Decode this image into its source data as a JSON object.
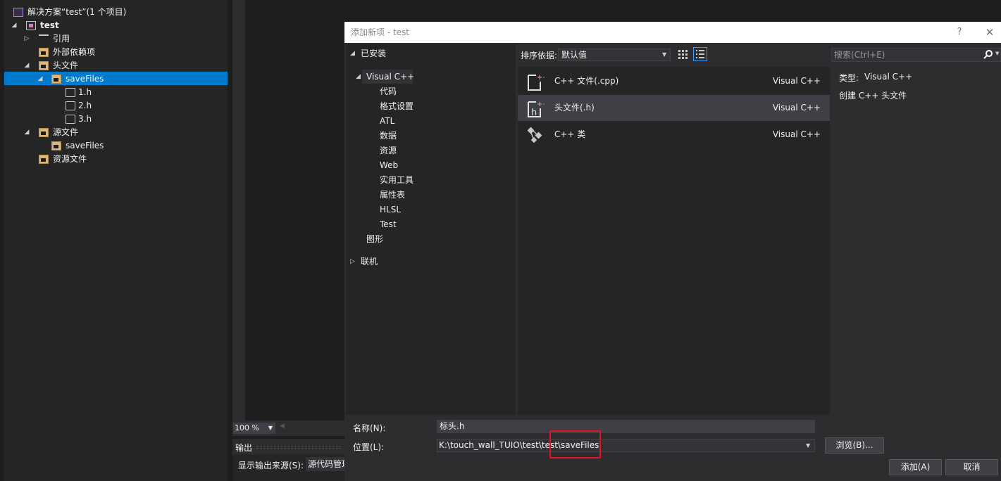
{
  "solution_explorer": {
    "solution_label": "解决方案“test”(1 个项目)",
    "project_label": "test",
    "items": [
      {
        "label": "引用"
      },
      {
        "label": "外部依赖项"
      },
      {
        "label": "头文件"
      },
      {
        "label": "saveFiles"
      },
      {
        "label": "1.h"
      },
      {
        "label": "2.h"
      },
      {
        "label": "3.h"
      },
      {
        "label": "源文件"
      },
      {
        "label": "saveFiles"
      },
      {
        "label": "资源文件"
      }
    ]
  },
  "editor": {
    "zoom": "100 %",
    "output_title": "输出",
    "output_source_label": "显示输出来源(S):",
    "output_source_value": "源代码管理"
  },
  "dialog": {
    "title": "添加新项 - test",
    "help": "?",
    "close": "✕",
    "installed": "已安装",
    "categories": {
      "root": "Visual C++",
      "children": [
        "代码",
        "格式设置",
        "ATL",
        "数据",
        "资源",
        "Web",
        "实用工具",
        "属性表",
        "HLSL",
        "Test"
      ],
      "graphics": "图形",
      "online": "联机"
    },
    "sort_label": "排序依据:",
    "sort_value": "默认值",
    "search_placeholder": "搜索(Ctrl+E)",
    "templates": [
      {
        "name": "C++ 文件(.cpp)",
        "type": "Visual C++",
        "icon": "cpp-file-icon"
      },
      {
        "name": "头文件(.h)",
        "type": "Visual C++",
        "icon": "header-file-icon"
      },
      {
        "name": "C++ 类",
        "type": "Visual C++",
        "icon": "cpp-class-icon"
      }
    ],
    "details": {
      "type_label": "类型:",
      "type_value": "Visual C++",
      "description": "创建 C++ 头文件"
    },
    "name_label": "名称(N):",
    "name_value": "标头.h",
    "location_label": "位置(L):",
    "location_value": "K:\\touch_wall_TUIO\\test\\test\\saveFiles",
    "browse_label": "浏览(B)...",
    "add_label": "添加(A)",
    "cancel_label": "取消"
  },
  "colors": {
    "accent": "#007acc",
    "highlight_box": "#e81123"
  }
}
